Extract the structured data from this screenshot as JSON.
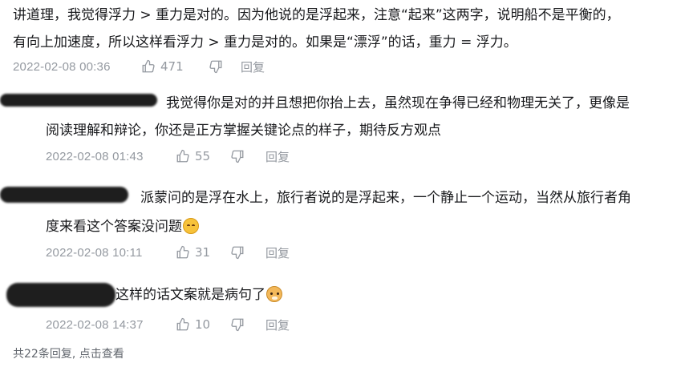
{
  "main_comment": {
    "line1": "讲道理，我觉得浮力 > 重力是对的。因为他说的是浮起来，注意“起来”这两字，说明船不是平衡的，",
    "line2": "有向上加速度，所以这样看浮力 > 重力是对的。如果是“漂浮”的话，重力 = 浮力。",
    "time": "2022-02-08 00:36",
    "likes": "471",
    "reply_label": "回复"
  },
  "replies": [
    {
      "line1": "我觉得你是对的并且想把你抬上去，虽然现在争得已经和物理无关了，更像是",
      "line2": "阅读理解和辩论，你还是正方掌握关键论点的样子，期待反方观点",
      "time": "2022-02-08 01:43",
      "likes": "55",
      "reply_label": "回复"
    },
    {
      "line1": "派蒙问的是浮在水上，旅行者说的是浮起来，一个静止一个运动，当然从旅行者角",
      "line2": "度来看这个答案没问题",
      "emoji": "crying-laughing-emoji",
      "time": "2022-02-08 10:11",
      "likes": "31",
      "reply_label": "回复"
    },
    {
      "line1": "这样的话文案就是病句了",
      "emoji": "doge-emoji",
      "time": "2022-02-08 14:37",
      "likes": "10",
      "reply_label": "回复"
    }
  ],
  "footer": {
    "text": "共22条回复, 点击查看"
  },
  "colors": {
    "text": "#18191c",
    "meta": "#9499a0",
    "footer": "#61666d"
  }
}
